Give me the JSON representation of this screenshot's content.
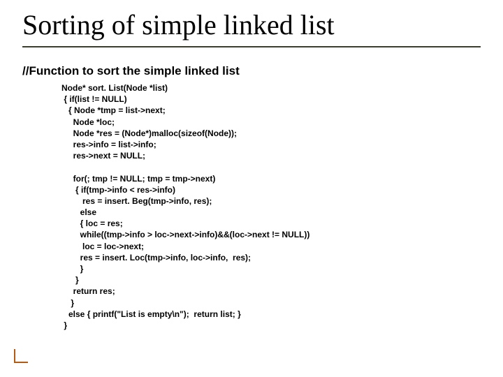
{
  "title": "Sorting of simple linked list",
  "subheading": "//Function to sort the simple linked list",
  "code": "Node* sort. List(Node *list)\n { if(list != NULL)\n   { Node *tmp = list->next;\n     Node *loc;\n     Node *res = (Node*)malloc(sizeof(Node));\n     res->info = list->info;\n     res->next = NULL;\n\n     for(; tmp != NULL; tmp = tmp->next)\n      { if(tmp->info < res->info)\n         res = insert. Beg(tmp->info, res);\n        else\n        { loc = res;\n        while((tmp->info > loc->next->info)&&(loc->next != NULL))\n         loc = loc->next;\n        res = insert. Loc(tmp->info, loc->info,  res);\n        }\n      }\n     return res;\n    }\n   else { printf(\"List is empty\\n\");  return list; }\n }"
}
